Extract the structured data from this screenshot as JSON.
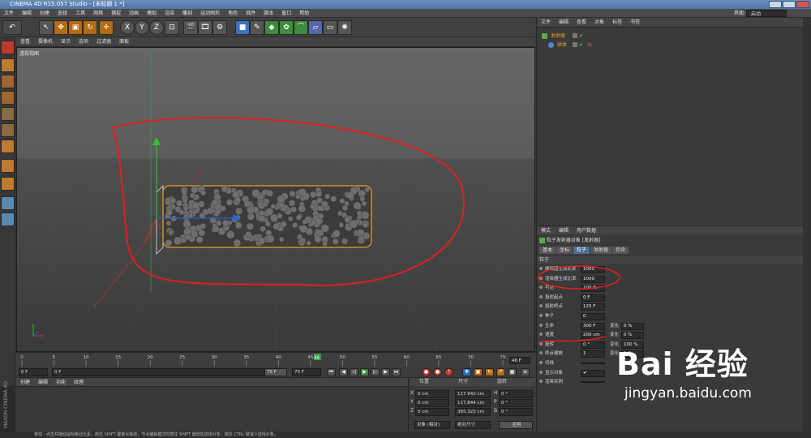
{
  "window": {
    "title": "CINEMA 4D R15.057 Studio - [未标题 1 *]"
  },
  "menubar": [
    "文件",
    "编辑",
    "创建",
    "选择",
    "工具",
    "网格",
    "捕捉",
    "动画",
    "模拟",
    "渲染",
    "雕刻",
    "运动图形",
    "角色",
    "插件",
    "脚本",
    "窗口",
    "帮助"
  ],
  "layout": {
    "label": "界面:",
    "value": "启动"
  },
  "toolbar": {
    "axis_x": "X",
    "axis_y": "Y",
    "axis_z": "Z"
  },
  "viewport": {
    "menu": [
      "查看",
      "摄像机",
      "显示",
      "选项",
      "过滤器",
      "面板"
    ],
    "label": "透视视图"
  },
  "timeline": {
    "ticks": [
      "0",
      "5",
      "10",
      "15",
      "20",
      "25",
      "30",
      "35",
      "40",
      "45",
      "50",
      "55",
      "60",
      "65",
      "70",
      "75"
    ],
    "current_frame": "46",
    "end_field": "46 F"
  },
  "transport": {
    "start": "0 F",
    "start2": "0 F",
    "end": "75 F",
    "end2": "75 F"
  },
  "material": {
    "menu": [
      "创建",
      "编辑",
      "功能",
      "纹理"
    ]
  },
  "coords": {
    "headers": {
      "pos": "位置",
      "size": "尺寸",
      "rot": "旋转"
    },
    "rows": [
      {
        "axis": "X",
        "pos": "0 cm",
        "size": "117.942 cm",
        "rot_axis": "H",
        "rot": "0 °"
      },
      {
        "axis": "Y",
        "pos": "0 cm",
        "size": "117.844 cm",
        "rot_axis": "P",
        "rot": "0 °"
      },
      {
        "axis": "Z",
        "pos": "0 cm",
        "size": "365.323 cm",
        "rot_axis": "B",
        "rot": "0 °"
      }
    ],
    "mode": "对象 (相对)",
    "size_mode": "绝对尺寸",
    "apply": "应用"
  },
  "status": "移动 : 点击并拖动鼠标移动元素。按住 SHIFT 键量化移动；节点编辑模式时按住 SHIFT 键增加选择对象；按住 CTRL 键减少选择对象。",
  "brand": "MAXON CINEMA 4D",
  "objects": {
    "menu": [
      "文件",
      "编辑",
      "查看",
      "对象",
      "标签",
      "书签"
    ],
    "items": [
      {
        "name": "发射器"
      },
      {
        "name": "球体"
      }
    ]
  },
  "attributes": {
    "menu": [
      "模式",
      "编辑",
      "用户数据"
    ],
    "object_title": "粒子发射器对象 [发射器]",
    "tabs": [
      "基本",
      "坐标",
      "粒子",
      "发射器",
      "包含"
    ],
    "active_tab": "粒子",
    "section": "粒子",
    "rows": [
      {
        "label": "编辑器生成比率",
        "value": "1000"
      },
      {
        "label": "渲染器生成比率",
        "value": "1000"
      },
      {
        "label": "可见",
        "value": "100 %"
      },
      {
        "label": "投射起点",
        "value": "0 F"
      },
      {
        "label": "投射终点",
        "value": "125 F"
      },
      {
        "label": "种子",
        "value": "0"
      },
      {
        "label": "生命",
        "value": "300 F",
        "var_label": "变化",
        "var": "0 %"
      },
      {
        "label": "速度",
        "value": "200 cm",
        "var_label": "变化",
        "var": "0 %"
      },
      {
        "label": "旋转",
        "value": "0 °",
        "var_label": "变化",
        "var": "100 %"
      },
      {
        "label": "终点缩放",
        "value": "1",
        "var_label": "变化",
        "var": "0 %"
      },
      {
        "label": "切线",
        "value": ""
      },
      {
        "label": "显示对象",
        "value": "✔"
      },
      {
        "label": "渲染实例",
        "value": ""
      }
    ]
  },
  "watermark": {
    "main": "Bai 经验",
    "sub": "jingyan.baidu.com"
  },
  "colors": {
    "annotation_red": "#e0201c",
    "selection_orange": "#f0a020",
    "accent_blue": "#4e6c96"
  }
}
